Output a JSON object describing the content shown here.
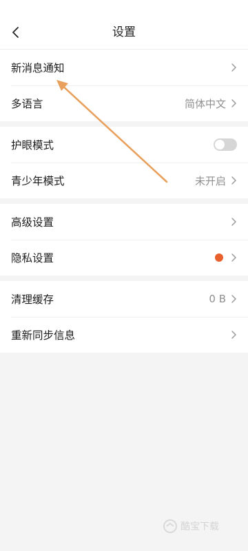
{
  "header": {
    "title": "设置"
  },
  "groups": [
    {
      "rows": [
        {
          "label": "新消息通知"
        },
        {
          "label": "多语言",
          "value": "简体中文"
        }
      ]
    },
    {
      "rows": [
        {
          "label": "护眼模式",
          "toggle_on": false
        },
        {
          "label": "青少年模式",
          "value": "未开启"
        }
      ]
    },
    {
      "rows": [
        {
          "label": "高级设置"
        },
        {
          "label": "隐私设置",
          "dot_color": "#e8612c"
        }
      ]
    },
    {
      "rows": [
        {
          "label": "清理缓存",
          "value": "0 B"
        },
        {
          "label": "重新同步信息"
        }
      ]
    }
  ],
  "colors": {
    "accent_arrow": "#e9a05c",
    "privacy_dot": "#e8612c"
  },
  "watermark": {
    "text": "酷宝下载"
  }
}
